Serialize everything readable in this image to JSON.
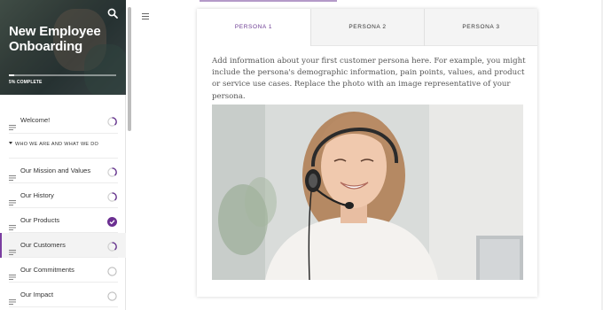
{
  "sidebar": {
    "hero_title": "New Employee Onboarding",
    "progress_percent": 5,
    "progress_text": "5% COMPLETE",
    "section_label": "WHO WE ARE AND WHAT WE DO",
    "items": [
      {
        "label": "Welcome!",
        "status": "in-progress"
      },
      {
        "label": "Our Mission and Values",
        "status": "in-progress"
      },
      {
        "label": "Our History",
        "status": "in-progress"
      },
      {
        "label": "Our Products",
        "status": "complete"
      },
      {
        "label": "Our Customers",
        "status": "in-progress",
        "active": true
      },
      {
        "label": "Our Commitments",
        "status": "not-started"
      },
      {
        "label": "Our Impact",
        "status": "not-started"
      }
    ]
  },
  "main": {
    "tabs": [
      "PERSONA 1",
      "PERSONA 2",
      "PERSONA 3"
    ],
    "active_tab": 0,
    "intro_text": "Add information about your first customer persona here. For example, you might include the persona's demographic information, pain points, values, and product or service use cases. Replace the photo with an image representative of your persona."
  },
  "colors": {
    "accent": "#6b3a92",
    "complete": "#6b2f91"
  },
  "icons": {
    "search": "search-icon",
    "menu": "hamburger-menu-icon",
    "lesson": "lesson-lines-icon",
    "status": "progress-circle-icon"
  }
}
